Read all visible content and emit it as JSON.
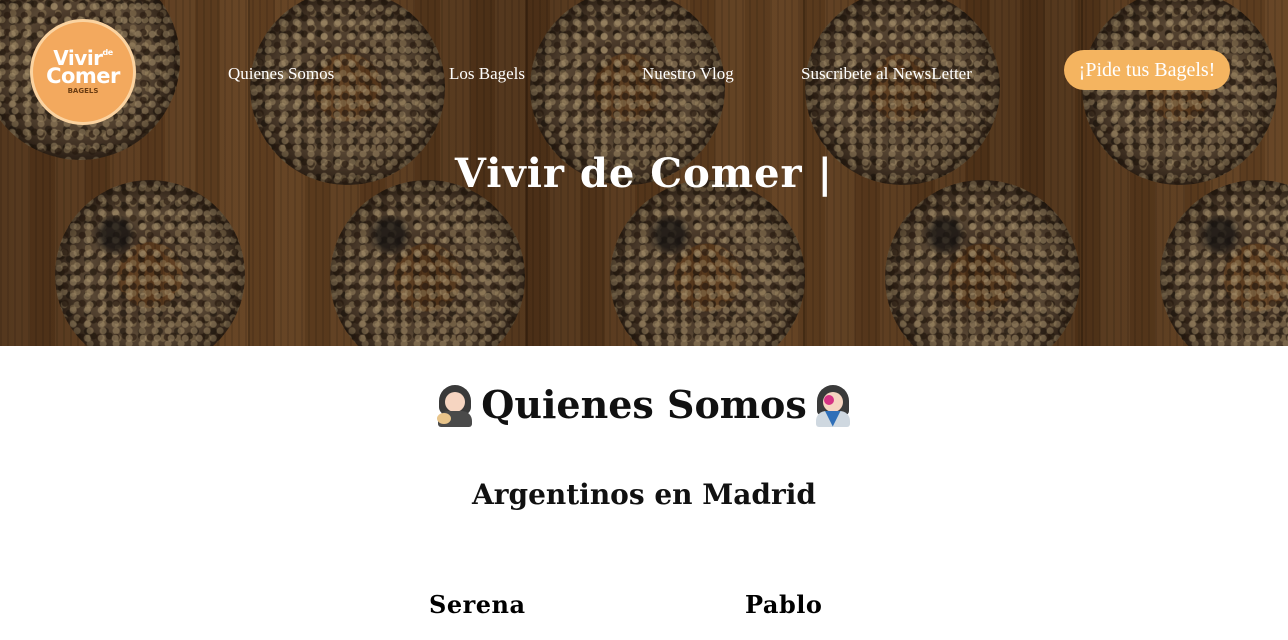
{
  "header": {
    "logo": {
      "line1": "Vivir",
      "line1_small": "de",
      "line2": "Comer",
      "line3": "BAGELS"
    },
    "nav": [
      {
        "label": "Quienes Somos"
      },
      {
        "label": "Los Bagels"
      },
      {
        "label": "Nuestro Vlog"
      },
      {
        "label": "Suscribete al NewsLetter"
      }
    ],
    "cta_label": "¡Pide tus Bagels!",
    "hero_title": "Vivir de Comer |"
  },
  "about": {
    "title": "Quienes Somos",
    "left_emoji": "artist-emoji",
    "right_emoji": "singer-emoji",
    "subtitle": "Argentinos en Madrid",
    "people": [
      {
        "name": "Serena"
      },
      {
        "name": "Pablo"
      }
    ]
  },
  "colors": {
    "accent": "#f4b460",
    "logo_bg": "#f3a95e",
    "text_dark": "#111111",
    "hero_text": "#ffffff"
  }
}
